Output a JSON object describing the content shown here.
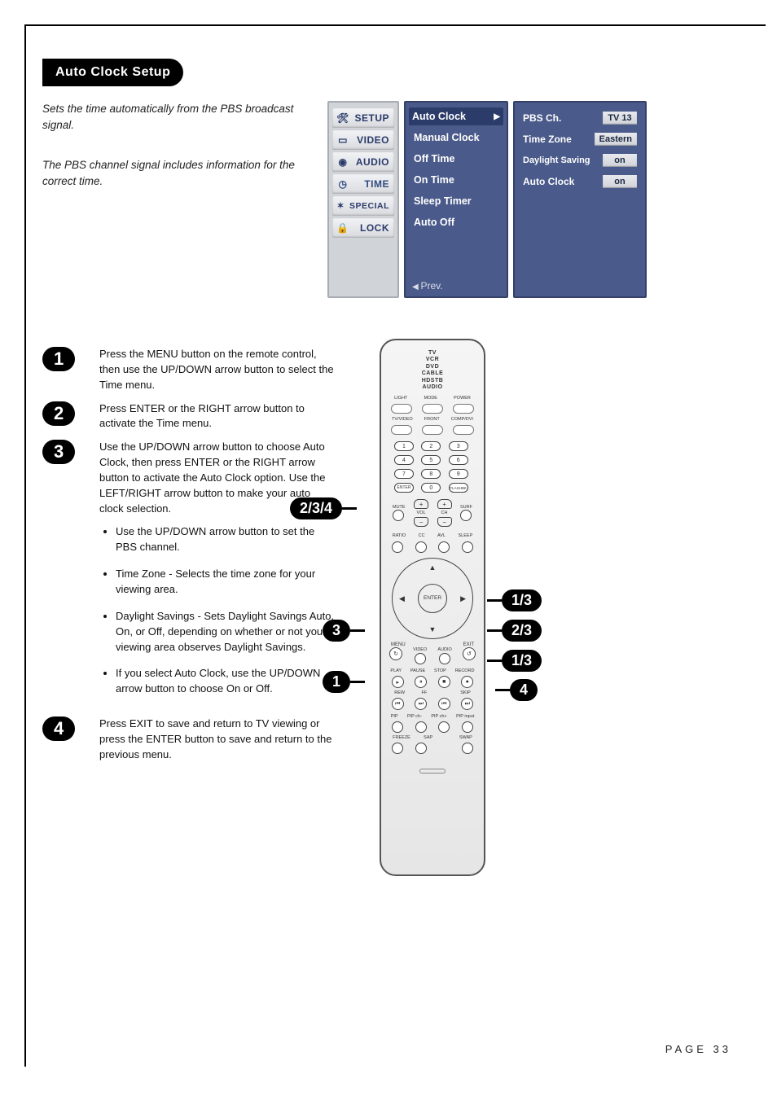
{
  "header": {
    "title": "Auto Clock Setup"
  },
  "intro": {
    "p1": "Sets the time automatically from the PBS broadcast signal.",
    "p2": "The PBS channel signal includes information for the correct time."
  },
  "osd": {
    "menu": {
      "items": [
        {
          "label": "SETUP",
          "icon": "wrench-icon"
        },
        {
          "label": "VIDEO",
          "icon": "monitor-icon"
        },
        {
          "label": "AUDIO",
          "icon": "speaker-icon"
        },
        {
          "label": "TIME",
          "icon": "clock-icon",
          "selected": true
        },
        {
          "label": "SPECIAL",
          "icon": "effects-icon"
        },
        {
          "label": "LOCK",
          "icon": "lock-icon"
        }
      ]
    },
    "submenu": {
      "items": [
        {
          "label": "Auto Clock",
          "selected": true,
          "hasArrow": true
        },
        {
          "label": "Manual Clock"
        },
        {
          "label": "Off Time"
        },
        {
          "label": "On Time"
        },
        {
          "label": "Sleep Timer"
        },
        {
          "label": "Auto Off"
        }
      ],
      "prev": "Prev."
    },
    "detail": {
      "rows": [
        {
          "label": "PBS Ch.",
          "value": "TV  13"
        },
        {
          "label": "Time Zone",
          "value": "Eastern"
        },
        {
          "label": "Daylight Saving",
          "value": "on"
        },
        {
          "label": "Auto Clock",
          "value": "on"
        }
      ]
    }
  },
  "steps": [
    {
      "num": "1",
      "text": "Press the MENU button on the remote control, then use the UP/DOWN arrow button to select the Time menu."
    },
    {
      "num": "2",
      "text": "Press ENTER or the RIGHT arrow button to activate the Time menu."
    },
    {
      "num": "3",
      "text": "Use the UP/DOWN arrow button to choose Auto Clock, then press ENTER or the RIGHT arrow button to activate the Auto Clock option. Use the LEFT/RIGHT arrow button to make your auto clock selection.",
      "bullets": [
        "Use the UP/DOWN arrow button to set the PBS channel.",
        "Time Zone - Selects the time zone for your viewing area.",
        "Daylight Savings - Sets Daylight Savings Auto, On, or Off, depending on whether or not your viewing area observes Daylight Savings.",
        "If you select Auto Clock, use the UP/DOWN arrow button to choose On or Off."
      ]
    },
    {
      "num": "4",
      "text": "Press EXIT to save and return to TV viewing or press the ENTER button to save and return to the previous menu."
    }
  ],
  "remote": {
    "modes": "TV\nVCR\nDVD\nCABLE\nHDSTB\nAUDIO",
    "topLabels": [
      "LIGHT",
      "MODE",
      "POWER"
    ],
    "inputLabels": [
      "TV/VIDEO",
      "FRONT",
      "COMP/DVI"
    ],
    "numbers": [
      "1",
      "2",
      "3",
      "4",
      "5",
      "6",
      "7",
      "8",
      "9",
      "ENTER",
      "0",
      "FLASHBK"
    ],
    "mute": "MUTE",
    "surf": "SURF",
    "vol": "VOL",
    "ch": "CH",
    "ratio": "RATIO",
    "cc": "CC",
    "avl": "AVL",
    "sleep": "SLEEP",
    "enter": "ENTER",
    "menu": "MENU",
    "exit": "EXIT",
    "av": [
      "VIDEO",
      "AUDIO"
    ],
    "transportLabels": [
      "PLAY",
      "PAUSE",
      "STOP",
      "RECORD"
    ],
    "transport2Labels": [
      "REW",
      "FF",
      "",
      "SKIP"
    ],
    "pip": [
      "PIP",
      "PIP ch-",
      "PIP ch+",
      "PIP input"
    ],
    "bottom": [
      "FREEZE",
      "SAP",
      "",
      "SWAP"
    ]
  },
  "callouts": {
    "c234": "2/3/4",
    "c3": "3",
    "c1": "1",
    "c13a": "1/3",
    "c23": "2/3",
    "c13b": "1/3",
    "c4": "4"
  },
  "footer": {
    "page": "PAGE 33"
  }
}
